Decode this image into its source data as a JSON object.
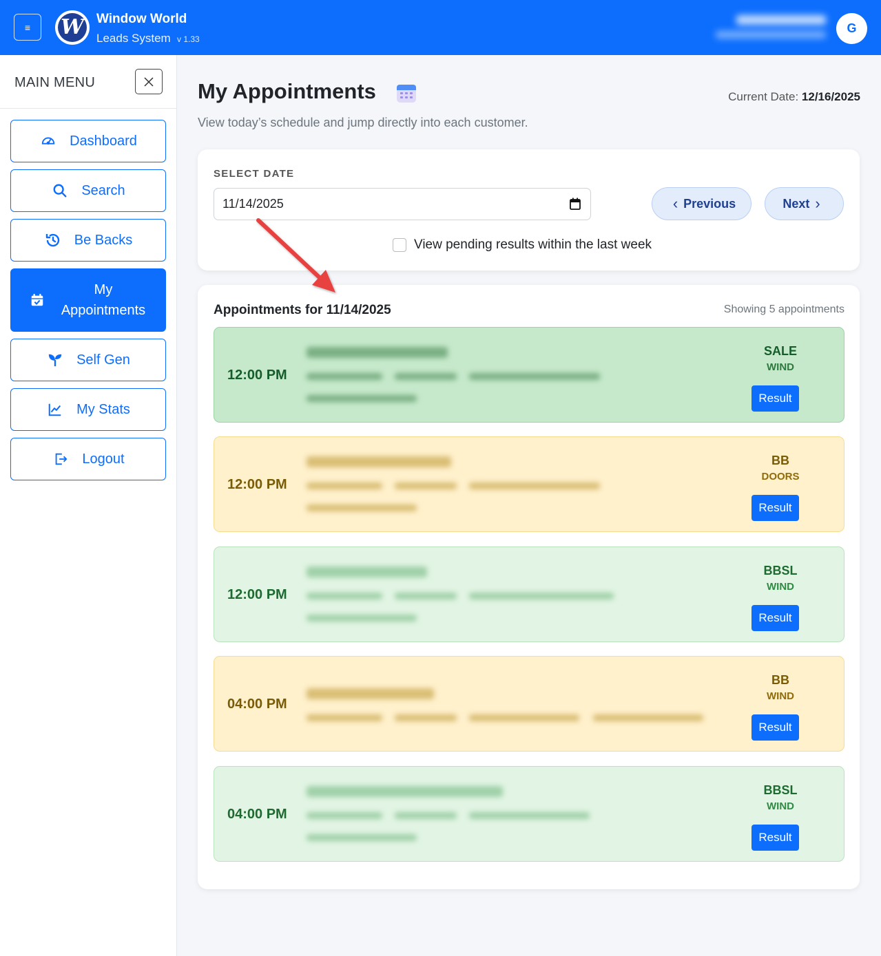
{
  "header": {
    "brand": "Window World",
    "subtitle": "Leads System",
    "version": "v 1.33",
    "avatar_initial": "G",
    "logo_letter": "W"
  },
  "sidebar": {
    "title": "MAIN MENU",
    "items": [
      {
        "label": "Dashboard",
        "icon": "gauge-icon"
      },
      {
        "label": "Search",
        "icon": "search-icon"
      },
      {
        "label": "Be Backs",
        "icon": "history-icon"
      },
      {
        "label": "My Appointments",
        "icon": "calendar-check-icon",
        "active": true
      },
      {
        "label": "Self Gen",
        "icon": "sprout-icon"
      },
      {
        "label": "My Stats",
        "icon": "chart-line-icon"
      },
      {
        "label": "Logout",
        "icon": "logout-icon"
      }
    ]
  },
  "page": {
    "title": "My Appointments",
    "subtitle": "View today’s schedule and jump directly into each customer.",
    "current_date_label": "Current Date:",
    "current_date": "12/16/2025"
  },
  "select": {
    "label": "SELECT DATE",
    "date_value": "11/14/2025",
    "prev_label": "Previous",
    "next_label": "Next",
    "pending_label": "View pending results within the last week",
    "pending_checked": false
  },
  "list": {
    "title": "Appointments for 11/14/2025",
    "count_text": "Showing 5 appointments",
    "result_label": "Result",
    "appointments": [
      {
        "time": "12:00 PM",
        "status": "SALE",
        "product": "WIND"
      },
      {
        "time": "12:00 PM",
        "status": "BB",
        "product": "DOORS"
      },
      {
        "time": "12:00 PM",
        "status": "BBSL",
        "product": "WIND"
      },
      {
        "time": "04:00 PM",
        "status": "BB",
        "product": "WIND"
      },
      {
        "time": "04:00 PM",
        "status": "BBSL",
        "product": "WIND"
      }
    ]
  },
  "colors": {
    "primary": "#0d6efd",
    "sale_bg": "#c6e9cb",
    "bb_bg": "#fff1cc",
    "bbsl_bg": "#e2f5e4",
    "annotation_arrow": "#e8423f"
  }
}
